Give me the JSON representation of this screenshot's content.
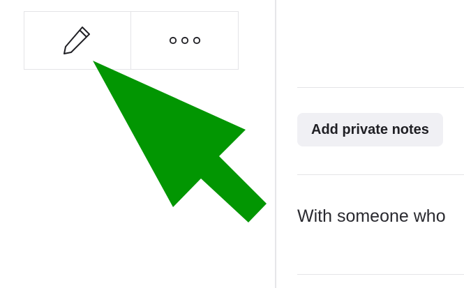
{
  "toolbar": {
    "edit_icon": "pencil-icon",
    "more_icon": "more-horizontal-icon"
  },
  "panel": {
    "notes_button_label": "Add private notes",
    "shared_text": "With someone who"
  },
  "overlay": {
    "arrow_color": "#029602"
  }
}
